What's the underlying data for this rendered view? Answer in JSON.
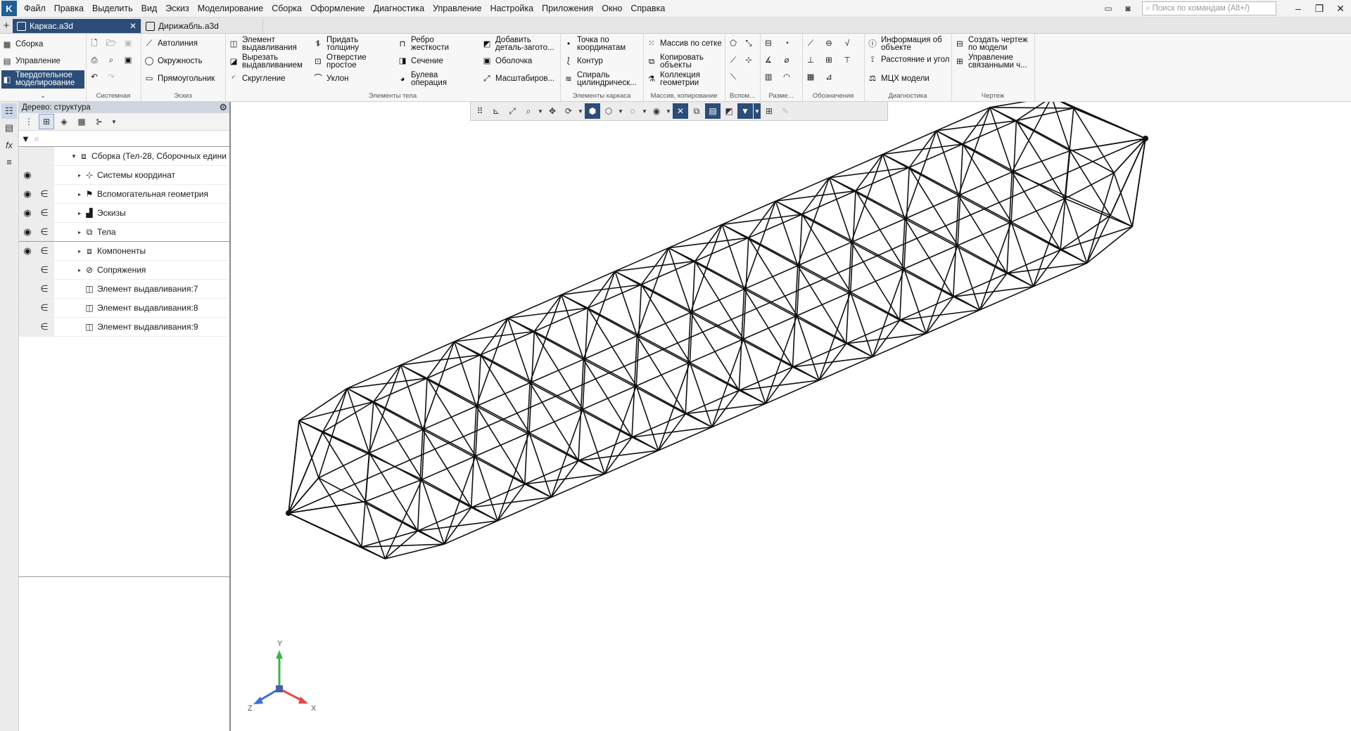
{
  "menu": {
    "items": [
      "Файл",
      "Правка",
      "Выделить",
      "Вид",
      "Эскиз",
      "Моделирование",
      "Сборка",
      "Оформление",
      "Диагностика",
      "Управление",
      "Настройка",
      "Приложения",
      "Окно",
      "Справка"
    ],
    "search_placeholder": "Поиск по командам (Alt+/)"
  },
  "tabs": [
    {
      "label": "Каркас.a3d",
      "active": true
    },
    {
      "label": "Дирижабль.a3d",
      "active": false
    }
  ],
  "ribbon": {
    "modes": [
      "Сборка",
      "Управление",
      "Твердотельное моделирование"
    ],
    "groups": {
      "system": "Системная",
      "sketch": "Эскиз",
      "body": "Элементы тела",
      "frame": "Элементы каркаса",
      "array": "Массив, копирование",
      "aux": "Вспом...",
      "dims": "Разме...",
      "marks": "Обозначения",
      "diag": "Диагностика",
      "drawing": "Чертеж"
    },
    "sketch_tools": [
      "Автолиния",
      "Окружность",
      "Прямоугольник"
    ],
    "body_col1": [
      "Элемент выдавливания",
      "Вырезать выдавливанием",
      "Скругление"
    ],
    "body_col2": [
      "Придать толщину",
      "Отверстие простое",
      "Уклон"
    ],
    "body_col3": [
      "Ребро жесткости",
      "Сечение",
      "Булева операция"
    ],
    "body_col4": [
      "Добавить деталь-загото...",
      "Оболочка",
      "Масштабиров..."
    ],
    "frame_tools": [
      "Точка по координатам",
      "Контур",
      "Спираль цилиндрическ..."
    ],
    "array_tools": [
      "Массив по сетке",
      "Копировать объекты",
      "Коллекция геометрии"
    ],
    "diag_tools": [
      "Информация об объекте",
      "Расстояние и угол",
      "МЦХ модели"
    ],
    "drawing_tools": [
      "Создать чертеж по модели",
      "Управление связанными ч..."
    ]
  },
  "tree": {
    "title": "Дерево: структура",
    "root": "Сборка (Тел-28, Сборочных едини",
    "items": [
      {
        "label": "Системы координат",
        "eye": true,
        "include": false
      },
      {
        "label": "Вспомогательная геометрия",
        "eye": true,
        "include": true
      },
      {
        "label": "Эскизы",
        "eye": true,
        "include": true
      },
      {
        "label": "Тела",
        "eye": true,
        "include": true
      },
      {
        "label": "Компоненты",
        "eye": true,
        "include": true
      },
      {
        "label": "Сопряжения",
        "eye": false,
        "include": true
      },
      {
        "label": "Элемент выдавливания:7",
        "eye": false,
        "include": true
      },
      {
        "label": "Элемент выдавливания:8",
        "eye": false,
        "include": true
      },
      {
        "label": "Элемент выдавливания:9",
        "eye": false,
        "include": true
      }
    ]
  },
  "triad": {
    "x": "X",
    "y": "Y",
    "z": "Z"
  },
  "colors": {
    "accent": "#2b4d78",
    "selection": "#56b7c9",
    "axis_x": "#e04a4a",
    "axis_y": "#3cb44b",
    "axis_z": "#3a6fd8"
  }
}
